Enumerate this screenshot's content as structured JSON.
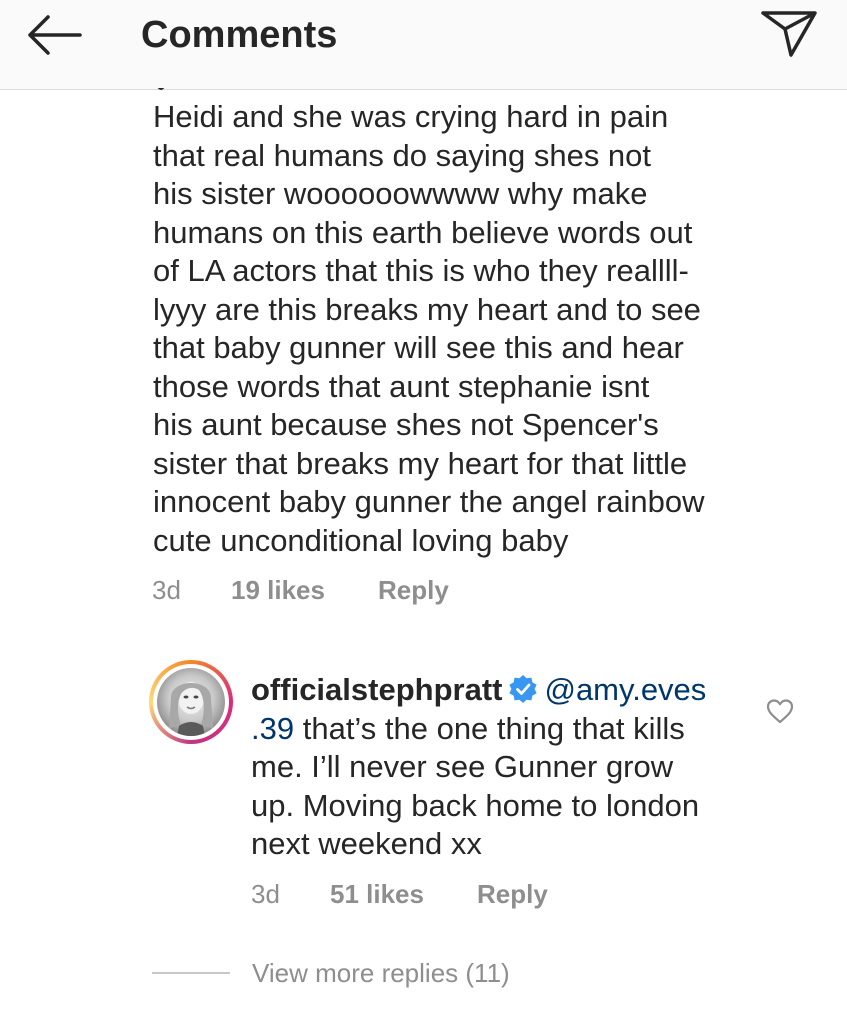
{
  "header": {
    "title": "Comments",
    "back_icon": "arrow-left-icon",
    "share_icon": "paper-plane-icon"
  },
  "comment": {
    "lines": [
      "Heidi and she was crying hard in pain",
      "that real humans do saying shes not",
      "his sister woooooowwww why make",
      "humans on this earth believe words out",
      "of LA actors that this is who they reallll-",
      "lyyy are this breaks my heart and to see",
      "that baby gunner will see this and hear",
      "those words that aunt stephanie isnt",
      "his aunt because shes not Spencer's",
      "sister that breaks my heart for that little",
      "innocent baby gunner the angel rainbow",
      "cute unconditional loving baby"
    ],
    "time": "3d",
    "likes": "19 likes",
    "reply_label": "Reply"
  },
  "reply": {
    "username": "officialstephpratt",
    "mention_part1": "@amy.eves",
    "mention_part2": ".39",
    "text_line1_rest": " that’s the one thing that kills",
    "text_lines": [
      "me. I’ll never see Gunner grow",
      "up. Moving back home to london",
      "next weekend xx"
    ],
    "time": "3d",
    "likes": "51 likes",
    "reply_label": "Reply",
    "verified_icon": "verified-badge-icon",
    "like_icon": "heart-outline-icon"
  },
  "more_replies": "View more replies (11)",
  "colors": {
    "text": "#262626",
    "muted": "#8e8e8e",
    "mention": "#00376b",
    "verified": "#3897f0",
    "header_bg": "#fafafa"
  }
}
